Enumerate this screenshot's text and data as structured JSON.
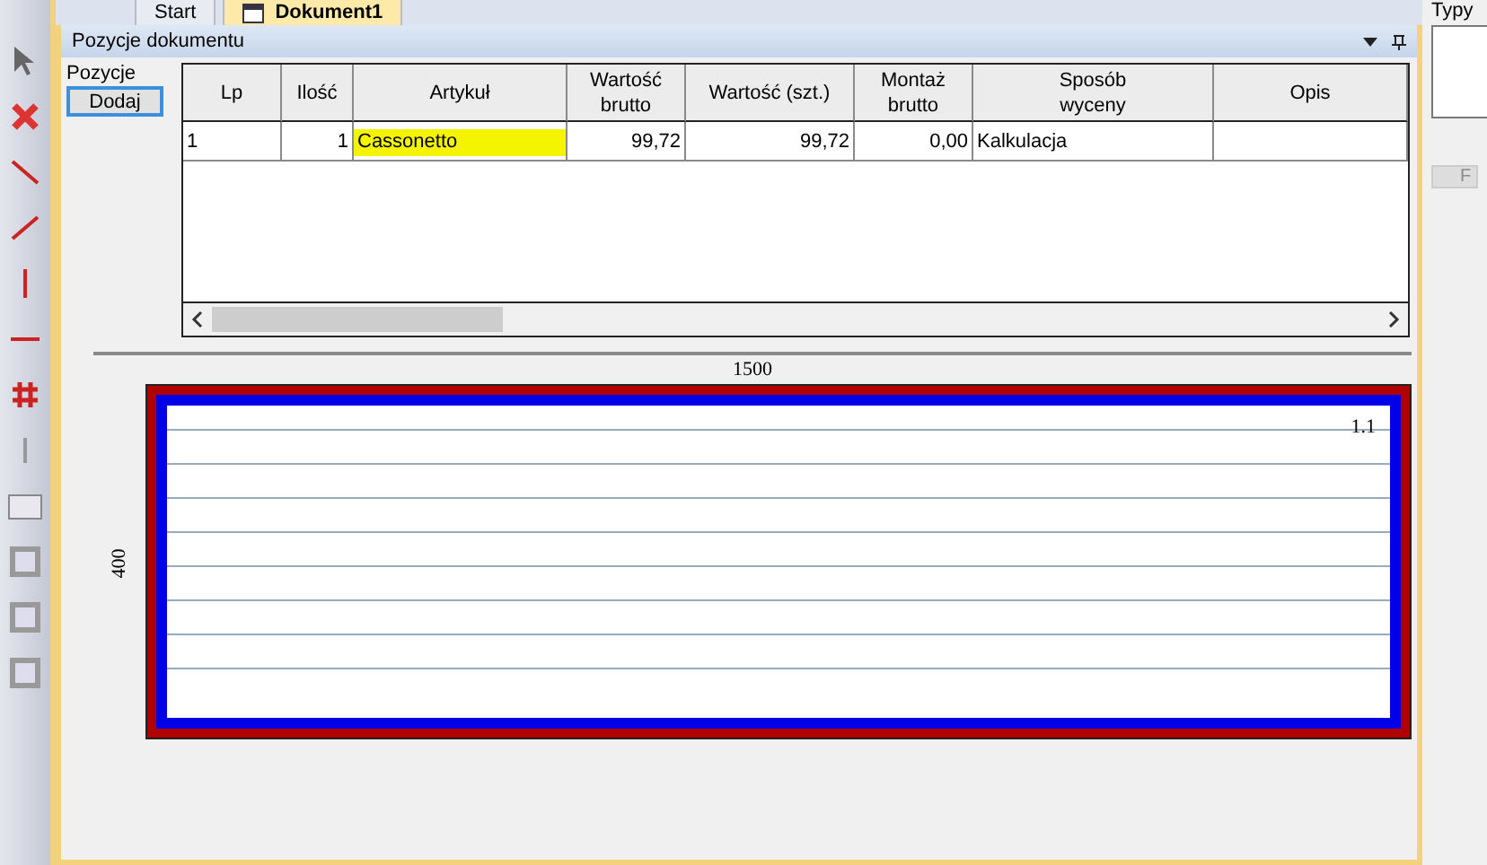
{
  "tabs": [
    {
      "label": "Start",
      "selected": false
    },
    {
      "label": "Dokument1",
      "selected": true
    }
  ],
  "right_panel": {
    "title": "Typy",
    "button": "F"
  },
  "panel": {
    "title": "Pozycje dokumentu",
    "side_label": "Pozycje",
    "add_button": "Dodaj"
  },
  "table": {
    "columns": [
      "Lp",
      "Ilość",
      "Artykuł",
      "Wartość\nbrutto",
      "Wartość (szt.)",
      "Montaż\nbrutto",
      "Sposób\nwyceny",
      "Opis"
    ],
    "rows": [
      {
        "cells": [
          {
            "text": "1",
            "highlighted": false
          },
          {
            "text": "1",
            "highlighted": false
          },
          {
            "text": "Cassonetto",
            "highlighted": true
          },
          {
            "text": "99,72",
            "highlighted": false
          },
          {
            "text": "99,72",
            "highlighted": false
          },
          {
            "text": "0,00",
            "highlighted": false
          },
          {
            "text": "Kalkulacja",
            "highlighted": false
          },
          {
            "text": "",
            "highlighted": false
          }
        ]
      }
    ]
  },
  "drawing": {
    "width_label": "1500",
    "height_label": "400",
    "sash_label": "1.1"
  }
}
